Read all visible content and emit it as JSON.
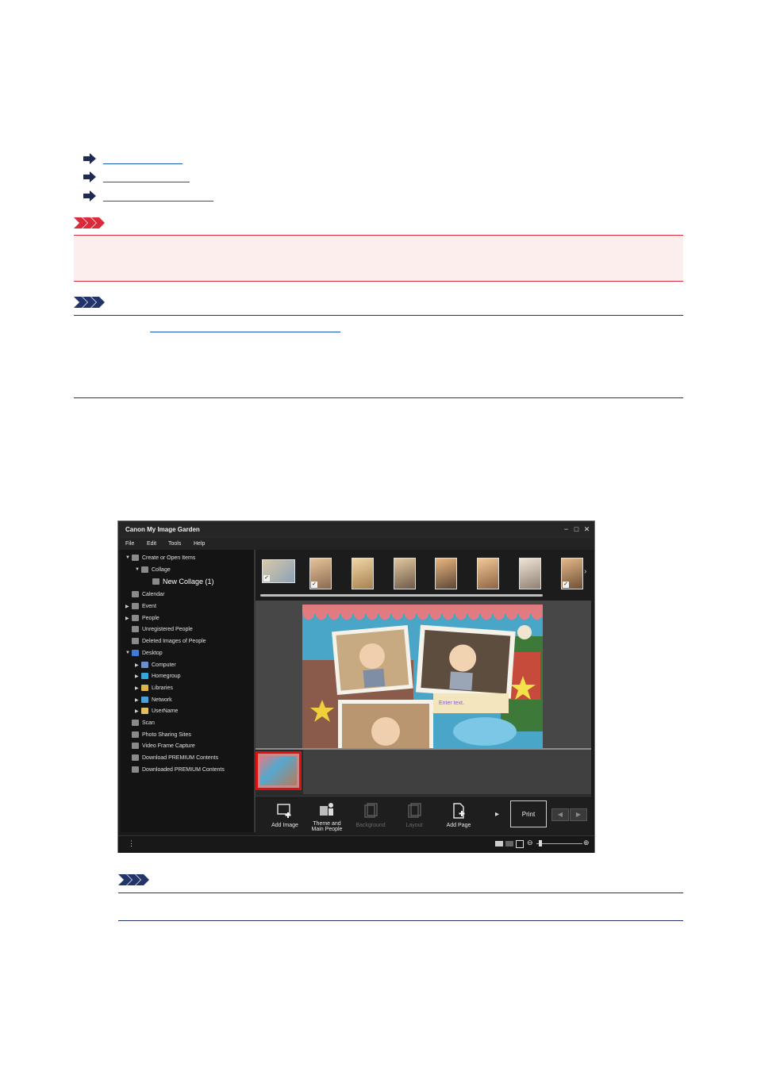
{
  "links": [
    {
      "label": ""
    },
    {
      "label": ""
    },
    {
      "label": ""
    }
  ],
  "app": {
    "title": "Canon My Image Garden",
    "window_controls": [
      "−",
      "□",
      "✕"
    ],
    "menu": [
      "File",
      "Edit",
      "Tools",
      "Help"
    ],
    "tree": [
      {
        "label": "Create or Open Items",
        "expand": "▼"
      },
      {
        "label": "Collage",
        "expand": "▼"
      },
      {
        "label": "New Collage (1)",
        "expand": ""
      },
      {
        "label": "Calendar",
        "expand": ""
      },
      {
        "label": "Event",
        "expand": "▶"
      },
      {
        "label": "People",
        "expand": "▶"
      },
      {
        "label": "Unregistered People",
        "expand": ""
      },
      {
        "label": "Deleted Images of People",
        "expand": ""
      },
      {
        "label": "Desktop",
        "expand": "▼"
      },
      {
        "label": "Computer",
        "expand": "▶"
      },
      {
        "label": "Homegroup",
        "expand": "▶"
      },
      {
        "label": "Libraries",
        "expand": "▶"
      },
      {
        "label": "Network",
        "expand": "▶"
      },
      {
        "label": "UserName",
        "expand": "▶"
      },
      {
        "label": "Scan",
        "expand": ""
      },
      {
        "label": "Photo Sharing Sites",
        "expand": ""
      },
      {
        "label": "Video Frame Capture",
        "expand": ""
      },
      {
        "label": "Download PREMIUM Contents",
        "expand": ""
      },
      {
        "label": "Downloaded PREMIUM Contents",
        "expand": ""
      }
    ],
    "canvas": {
      "placeholder_text": "Enter text."
    },
    "toolbar": {
      "add_image": "Add Image",
      "theme_line1": "Theme and",
      "theme_line2": "Main People",
      "background": "Background",
      "layout": "Layout",
      "add_page": "Add Page",
      "print": "Print"
    },
    "colors": {
      "selection_border": "#e01010",
      "window_bg": "#1b1b1b"
    }
  }
}
